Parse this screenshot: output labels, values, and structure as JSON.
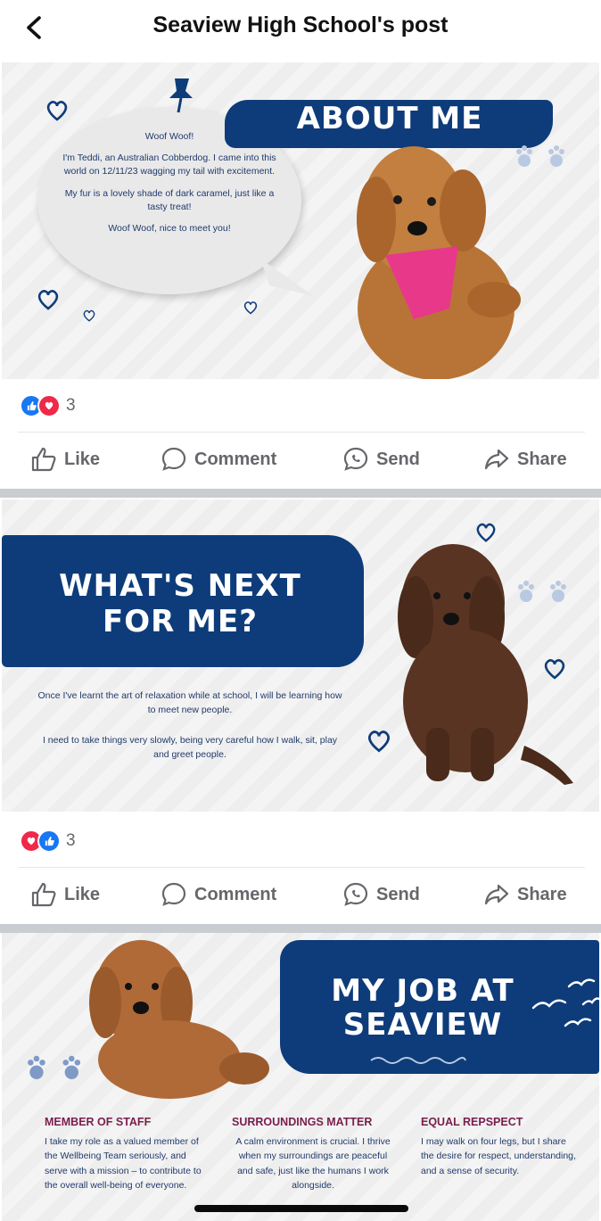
{
  "header": {
    "title": "Seaview High School's post"
  },
  "post1": {
    "banner": "ABOUT ME",
    "bubble_lines": [
      "Woof Woof!",
      "I'm Teddi, an Australian Cobberdog. I came into this world on 12/11/23 wagging my tail with excitement.",
      "My fur is a lovely shade of dark caramel, just like a tasty treat!",
      "Woof Woof, nice to meet you!"
    ],
    "reaction_count": "3"
  },
  "post2": {
    "banner_line1": "WHAT'S NEXT",
    "banner_line2": "FOR ME?",
    "paragraph1": "Once I've learnt the art of relaxation while at school, I will be learning how to meet new people.",
    "paragraph2": "I need to take things very slowly, being very careful how I walk, sit, play and greet people.",
    "reaction_count": "3"
  },
  "post3": {
    "banner_line1": "MY JOB AT",
    "banner_line2": "SEAVIEW",
    "columns": [
      {
        "heading": "MEMBER OF STAFF",
        "text": "I take my role as a valued member of the Wellbeing Team seriously, and serve with a mission – to contribute to the overall well-being of everyone."
      },
      {
        "heading": "SURROUNDINGS MATTER",
        "text": "A calm environment is crucial. I thrive when my surroundings are peaceful and safe, just like the humans I work alongside."
      },
      {
        "heading": "EQUAL REPSPECT",
        "text": "I may walk on four legs, but I share the desire for respect, understanding, and a sense of security."
      }
    ]
  },
  "actions": {
    "like": "Like",
    "comment": "Comment",
    "send": "Send",
    "share": "Share"
  },
  "colors": {
    "brand_navy": "#0e3c7a",
    "like_blue": "#1877f2",
    "love_red": "#f02849",
    "heading_maroon": "#7a1e4d"
  },
  "icons": [
    "back-chevron-icon",
    "like-reaction-icon",
    "love-reaction-icon",
    "thumbs-up-icon",
    "comment-bubble-icon",
    "messenger-send-icon",
    "share-arrow-icon",
    "heart-doodle-icon",
    "paw-print-icon",
    "push-pin-icon",
    "seagull-icon"
  ]
}
